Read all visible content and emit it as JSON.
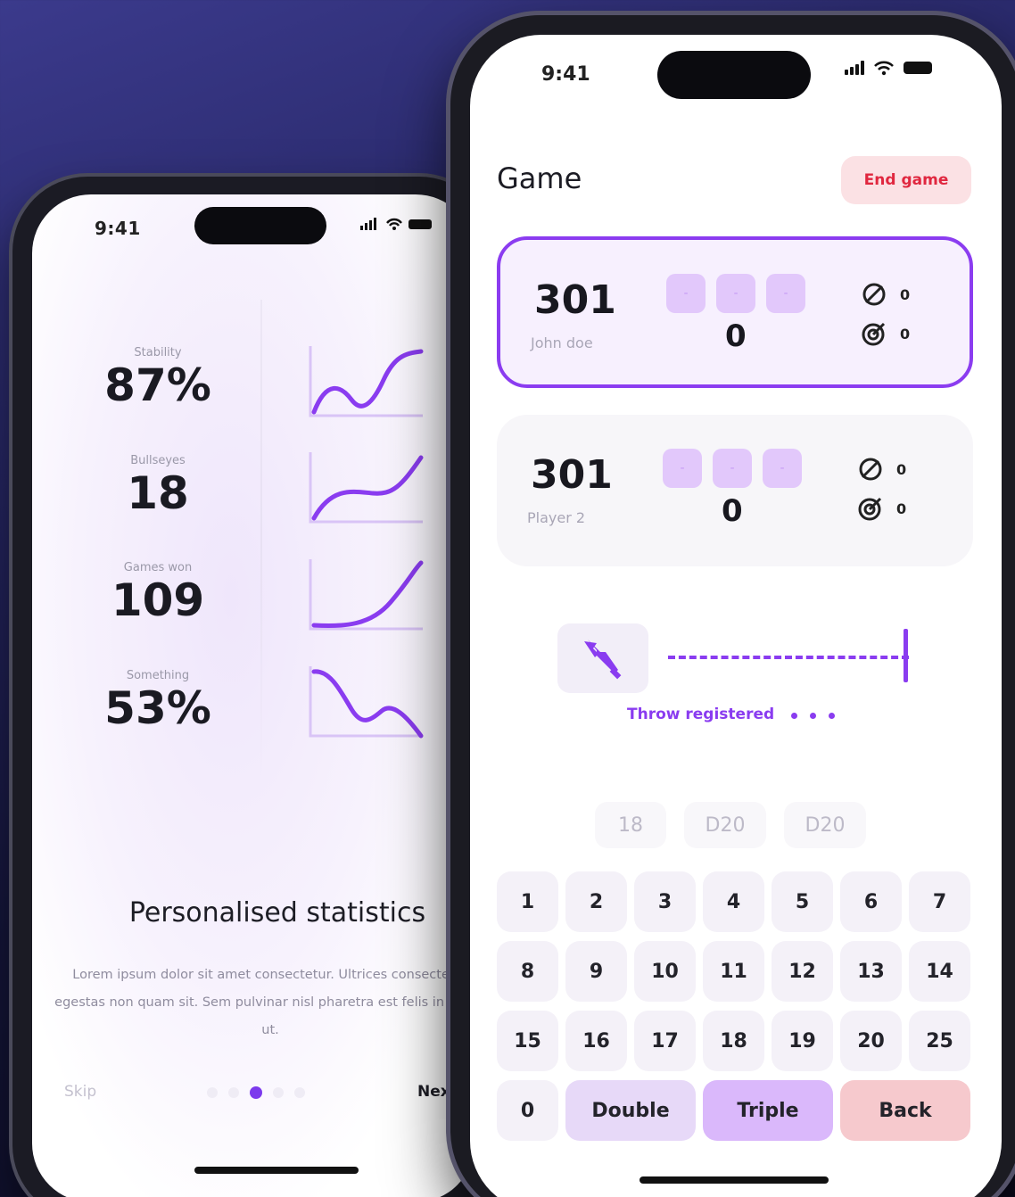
{
  "back_phone": {
    "time": "9:41",
    "stats": [
      {
        "label": "Stability",
        "value": "87%"
      },
      {
        "label": "Bullseyes",
        "value": "18"
      },
      {
        "label": "Games won",
        "value": "109"
      },
      {
        "label": "Something",
        "value": "53%"
      }
    ],
    "heading": "Personalised statistics",
    "body": "Lorem ipsum dolor sit amet consectetur. Ultrices consectetur egestas non quam sit. Sem pulvinar nisl pharetra est felis in morbi ut.",
    "skip_label": "Skip",
    "next_label": "Next",
    "page_count": 5,
    "active_page": 3
  },
  "front_phone": {
    "time": "9:41",
    "title": "Game",
    "end_game_label": "End game",
    "players": [
      {
        "score": "301",
        "name": "John doe",
        "round_score": "0",
        "throws": [
          "-",
          "-",
          "-"
        ],
        "misses": "0",
        "hits": "0",
        "active": true
      },
      {
        "score": "301",
        "name": "Player 2",
        "round_score": "0",
        "throws": [
          "-",
          "-",
          "-"
        ],
        "misses": "0",
        "hits": "0",
        "active": false
      }
    ],
    "throw_status": "Throw registered",
    "recent_throws": [
      "18",
      "D20",
      "D20"
    ],
    "keypad_rows": [
      [
        "1",
        "2",
        "3",
        "4",
        "5",
        "6",
        "7"
      ],
      [
        "8",
        "9",
        "10",
        "11",
        "12",
        "13",
        "14"
      ],
      [
        "15",
        "16",
        "17",
        "18",
        "19",
        "20",
        "25"
      ]
    ],
    "zero_label": "0",
    "double_label": "Double",
    "triple_label": "Triple",
    "back_label": "Back"
  },
  "colors": {
    "accent": "#8a3cf0",
    "danger": "#e0273f",
    "danger_bg": "#fbe1e4"
  }
}
